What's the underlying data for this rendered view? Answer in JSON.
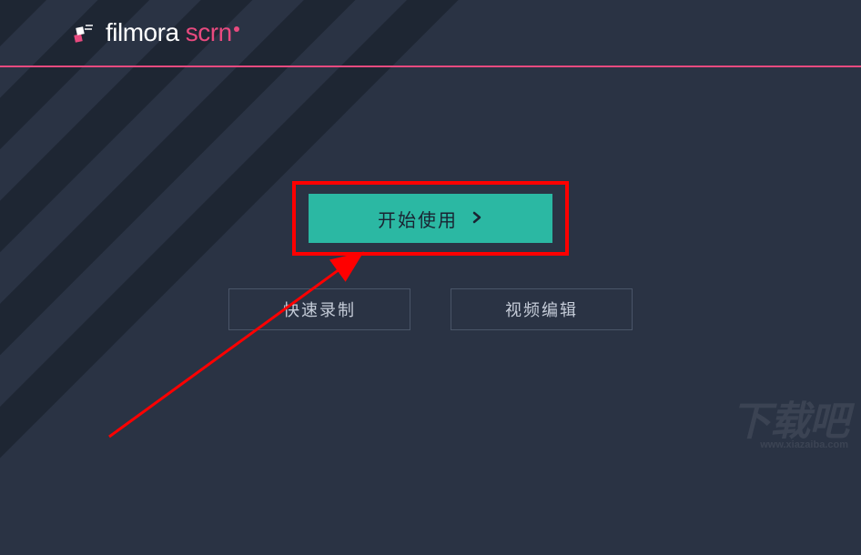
{
  "header": {
    "logo": {
      "brand_primary": "filmora",
      "brand_accent": " scrn"
    }
  },
  "buttons": {
    "primary": {
      "label": "开始使用"
    },
    "secondary": [
      {
        "label": "快速录制"
      },
      {
        "label": "视频编辑"
      }
    ]
  },
  "colors": {
    "accent_pink": "#e84a7f",
    "accent_teal": "#2bb8a3",
    "background": "#2a3344",
    "highlight_red": "#ff0000"
  },
  "watermark": {
    "text": "下载吧",
    "url": "www.xiazaiba.com"
  }
}
